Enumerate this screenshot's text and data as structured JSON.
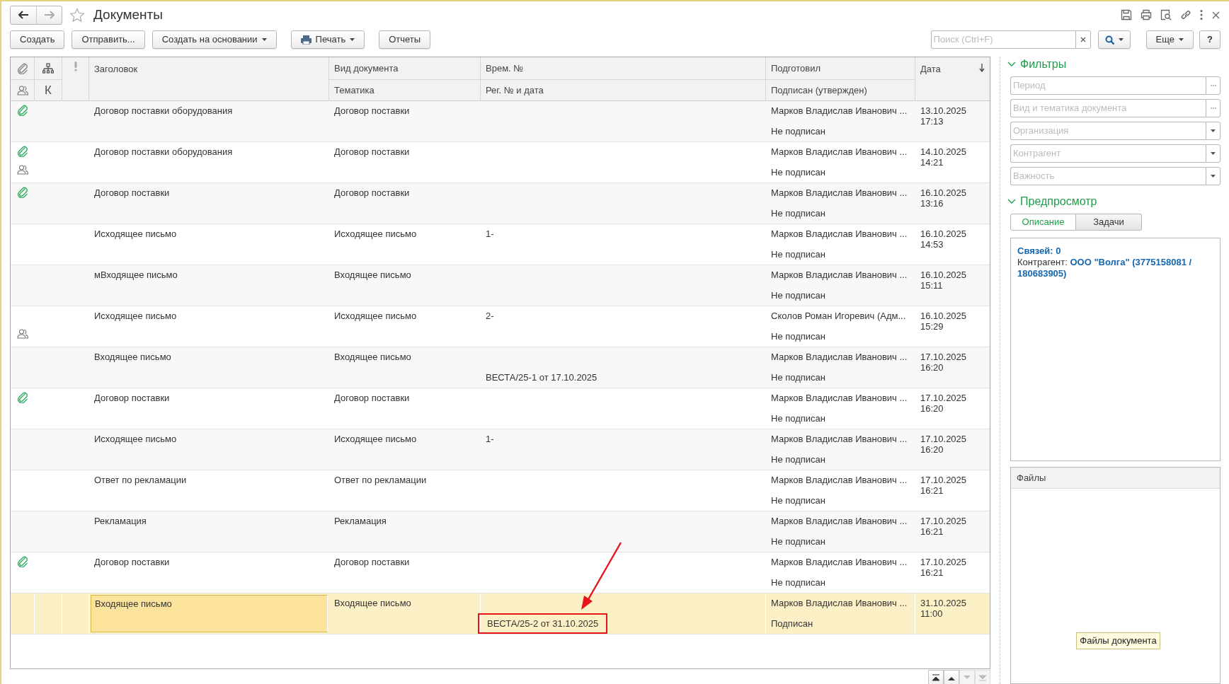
{
  "window": {
    "title": "Документы",
    "favorite": false,
    "back_enabled": true,
    "forward_enabled": false
  },
  "toolbar": {
    "buttons": [
      {
        "label": "Создать",
        "kind": "plain"
      },
      {
        "label": "Отправить...",
        "kind": "plain"
      },
      {
        "label": "Создать на основании",
        "kind": "menu"
      },
      {
        "label": "Печать",
        "kind": "print"
      },
      {
        "label": "Отчеты",
        "kind": "plain"
      }
    ],
    "search": {
      "placeholder": "Поиск (Ctrl+F)"
    },
    "more": "Еще",
    "help": "?"
  },
  "table": {
    "header_top": [
      "Вид документа",
      "Врем. №",
      "Подготовил"
    ],
    "header_bottom": [
      "Тематика",
      "Рег. № и дата",
      "Подписан (утвержден)"
    ],
    "title_column": "Заголовок",
    "date_column": "Дата",
    "k_column": "К",
    "rows": [
      {
        "attachment": true,
        "participants": false,
        "title": "Договор поставки оборудования",
        "type": "Договор поставки",
        "author": "Марков Владислав Иванович ...",
        "signature": "Не подписан",
        "date": "13.10.2025",
        "time": "17:13",
        "selected": false,
        "marked": false
      },
      {
        "attachment": true,
        "participants": true,
        "title": "Договор поставки оборудования",
        "type": "Договор поставки",
        "author": "Марков Владислав Иванович ...",
        "signature": "Не подписан",
        "date": "14.10.2025",
        "time": "14:21",
        "selected": false,
        "marked": false
      },
      {
        "attachment": true,
        "participants": false,
        "title": "Договор поставки",
        "type": "Договор поставки",
        "author": "Марков Владислав Иванович ...",
        "signature": "Не подписан",
        "date": "16.10.2025",
        "time": "13:16",
        "selected": false,
        "marked": false
      },
      {
        "attachment": false,
        "participants": false,
        "title": "Исходящее письмо",
        "type": "Исходящее письмо",
        "number": "1-",
        "author": "Марков Владислав Иванович ...",
        "signature": "Не подписан",
        "date": "16.10.2025",
        "time": "14:53",
        "selected": false,
        "marked": false
      },
      {
        "attachment": false,
        "participants": false,
        "title": "мВходящее письмо",
        "type": "Входящее письмо",
        "author": "Марков Владислав Иванович ...",
        "signature": "Не подписан",
        "date": "16.10.2025",
        "time": "15:11",
        "selected": false,
        "marked": false
      },
      {
        "attachment": false,
        "participants": true,
        "title": "Исходящее письмо",
        "type": "Исходящее письмо",
        "number": "2-",
        "author": "Сколов Роман Игоревич (Адм...",
        "signature": "Не подписан",
        "date": "16.10.2025",
        "time": "15:29",
        "selected": false,
        "marked": false
      },
      {
        "attachment": false,
        "participants": false,
        "title": "Входящее письмо",
        "type": "Входящее письмо",
        "reg": "ВЕСТА/25-1 от 17.10.2025",
        "author": "Марков Владислав Иванович ...",
        "signature": "Не подписан",
        "date": "17.10.2025",
        "time": "16:20",
        "selected": false,
        "marked": false
      },
      {
        "attachment": true,
        "participants": false,
        "title": "Договор поставки",
        "type": "Договор поставки",
        "author": "Марков Владислав Иванович ...",
        "signature": "Не подписан",
        "date": "17.10.2025",
        "time": "16:20",
        "selected": false,
        "marked": false
      },
      {
        "attachment": false,
        "participants": false,
        "title": "Исходящее письмо",
        "type": "Исходящее письмо",
        "number": "1-",
        "author": "Марков Владислав Иванович ...",
        "signature": "Не подписан",
        "date": "17.10.2025",
        "time": "16:20",
        "selected": false,
        "marked": false
      },
      {
        "attachment": false,
        "participants": false,
        "title": "Ответ по рекламации",
        "type": "Ответ по рекламации",
        "author": "Марков Владислав Иванович ...",
        "signature": "Не подписан",
        "date": "17.10.2025",
        "time": "16:21",
        "selected": false,
        "marked": false
      },
      {
        "attachment": false,
        "participants": false,
        "title": "Рекламация",
        "type": "Рекламация",
        "author": "Марков Владислав Иванович ...",
        "signature": "Не подписан",
        "date": "17.10.2025",
        "time": "16:21",
        "selected": false,
        "marked": false
      },
      {
        "attachment": true,
        "participants": false,
        "title": "Договор поставки",
        "type": "Договор поставки",
        "author": "Марков Владислав Иванович ...",
        "signature": "Не подписан",
        "date": "17.10.2025",
        "time": "16:21",
        "selected": false,
        "marked": false
      },
      {
        "attachment": false,
        "participants": false,
        "title": "Входящее письмо",
        "type": "Входящее письмо",
        "reg": "ВЕСТА/25-2 от 31.10.2025",
        "author": "Марков Владислав Иванович ...",
        "signature": "Подписан",
        "date": "31.10.2025",
        "time": "11:00",
        "selected": true,
        "marked": true
      }
    ],
    "nav_buttons": [
      {
        "kind": "first",
        "disabled": false
      },
      {
        "kind": "up",
        "disabled": false
      },
      {
        "kind": "down",
        "disabled": true
      },
      {
        "kind": "last",
        "disabled": true
      }
    ]
  },
  "filters": {
    "title": "Фильтры",
    "expanded": true,
    "fields": [
      {
        "placeholder": "Период",
        "kind": "choice"
      },
      {
        "placeholder": "Вид и тематика документа",
        "kind": "choice"
      },
      {
        "placeholder": "Организация",
        "kind": "dropdown"
      },
      {
        "placeholder": "Контрагент",
        "kind": "dropdown"
      },
      {
        "placeholder": "Важность",
        "kind": "dropdown"
      }
    ]
  },
  "preview": {
    "title": "Предпросмотр",
    "expanded": true,
    "tabs": [
      {
        "label": "Описание",
        "selected": true
      },
      {
        "label": "Задачи",
        "selected": false
      }
    ],
    "links": "Связей: 0",
    "counterparty": "Контрагент: **ООО \"Волга\" (3775158081 / 180683905)**"
  },
  "files": {
    "title": "Файлы",
    "tooltip": "Файлы документа"
  }
}
